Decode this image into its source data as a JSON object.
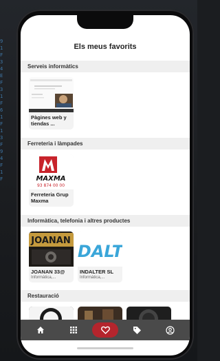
{
  "page": {
    "title": "Els meus favorits"
  },
  "sections": [
    {
      "title": "Serveis informàtics",
      "items": [
        {
          "name": "Pàgines web y tiendas ...",
          "subtitle": ""
        }
      ]
    },
    {
      "title": "Ferreteria i làmpades",
      "items": [
        {
          "name": "Ferreteria Grup Maxma",
          "subtitle": ""
        }
      ]
    },
    {
      "title": "Informàtica, telefonia i altres productes",
      "items": [
        {
          "name": "JOANAN 33@",
          "subtitle": "Informàtica,..."
        },
        {
          "name": "INDALTER SL",
          "subtitle": "Informàtica,..."
        }
      ]
    },
    {
      "title": "Restauració",
      "items": []
    }
  ],
  "logos": {
    "maxma_text": "MAXMA",
    "maxma_phone": "93 874 00 00",
    "joanan_text": "JOANAN",
    "indalter_text": "DALT"
  },
  "tabs": [
    {
      "icon": "home-icon",
      "active": false
    },
    {
      "icon": "grid-icon",
      "active": false
    },
    {
      "icon": "heart-icon",
      "active": true
    },
    {
      "icon": "tag-icon",
      "active": false
    },
    {
      "icon": "user-icon",
      "active": false
    }
  ],
  "colors": {
    "accent": "#b4252d",
    "tabbar": "#4a4a4a",
    "section_bg": "#efefef",
    "maxma_red": "#c8232b",
    "indalter_blue": "#3aa6d9"
  }
}
